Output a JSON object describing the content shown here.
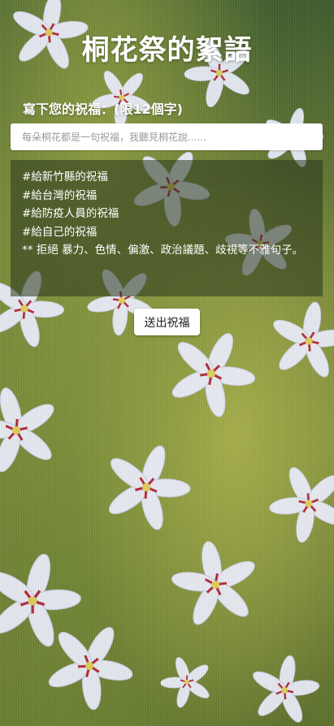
{
  "page": {
    "title": "桐花祭的絮語",
    "subtitle": "寫下您的祝福：(限12個字)"
  },
  "form": {
    "input_value": "",
    "input_placeholder": "每朵桐花都是一句祝福，我聽見桐花說......",
    "send_label": "送出祝福"
  },
  "tips": [
    "#給新竹縣的祝福",
    "#給台灣的祝福",
    "#給防疫人員的祝福",
    "#給自己的祝福",
    "** 拒絕 暴力、色情、偏激、政治議題、歧視等不雅句子。"
  ],
  "colors": {
    "text": "#ffffff",
    "panel": "#28341e",
    "background_green": "#6d7f33",
    "flower": "#eef0ff",
    "flower_center": "#b4223a"
  },
  "icons": [
    "tung-flower"
  ]
}
